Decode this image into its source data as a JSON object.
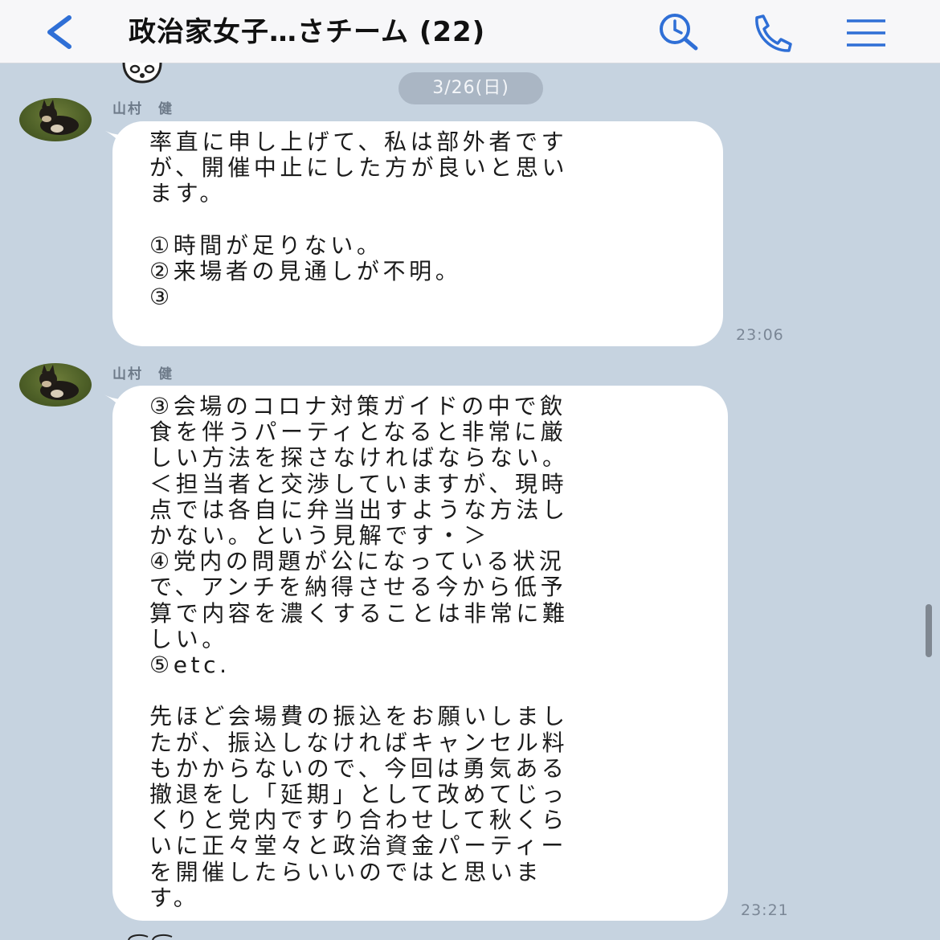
{
  "header": {
    "back_icon": "chevron-left-icon",
    "title": "政治家女子…さチーム (22)",
    "search_icon": "search-clock-icon",
    "call_icon": "phone-icon",
    "menu_icon": "hamburger-menu-icon",
    "accent_color": "#2f6fd6"
  },
  "chat": {
    "background_color": "#c6d3e0",
    "date_separator": "3/26(日)",
    "messages": [
      {
        "sender": "山村　健",
        "text": "率直に申し上げて、私は部外者です\nが、開催中止にした方が良いと思い\nます。\n\n①時間が足りない。\n②来場者の見通しが不明。\n③",
        "time": "23:06"
      },
      {
        "sender": "山村　健",
        "text": "③会場のコロナ対策ガイドの中で飲\n食を伴うパーティとなると非常に厳\nしい方法を探さなければならない。\n＜担当者と交渉していますが、現時\n点では各自に弁当出すような方法し\nかない。という見解です・＞\n④党内の問題が公になっている状況\nで、アンチを納得させる今から低予\n算で内容を濃くすることは非常に難\nしい。\n⑤etc.\n\n先ほど会場費の振込をお願いしまし\nたが、振込しなければキャンセル料\nもかからないので、今回は勇気ある\n撤退をし「延期」として改めてじっ\nくりと党内ですり合わせして秋くら\nいに正々堂々と政治資金パーティー\nを開催したらいいのではと思いま\nす。",
        "time": "23:21"
      }
    ]
  }
}
